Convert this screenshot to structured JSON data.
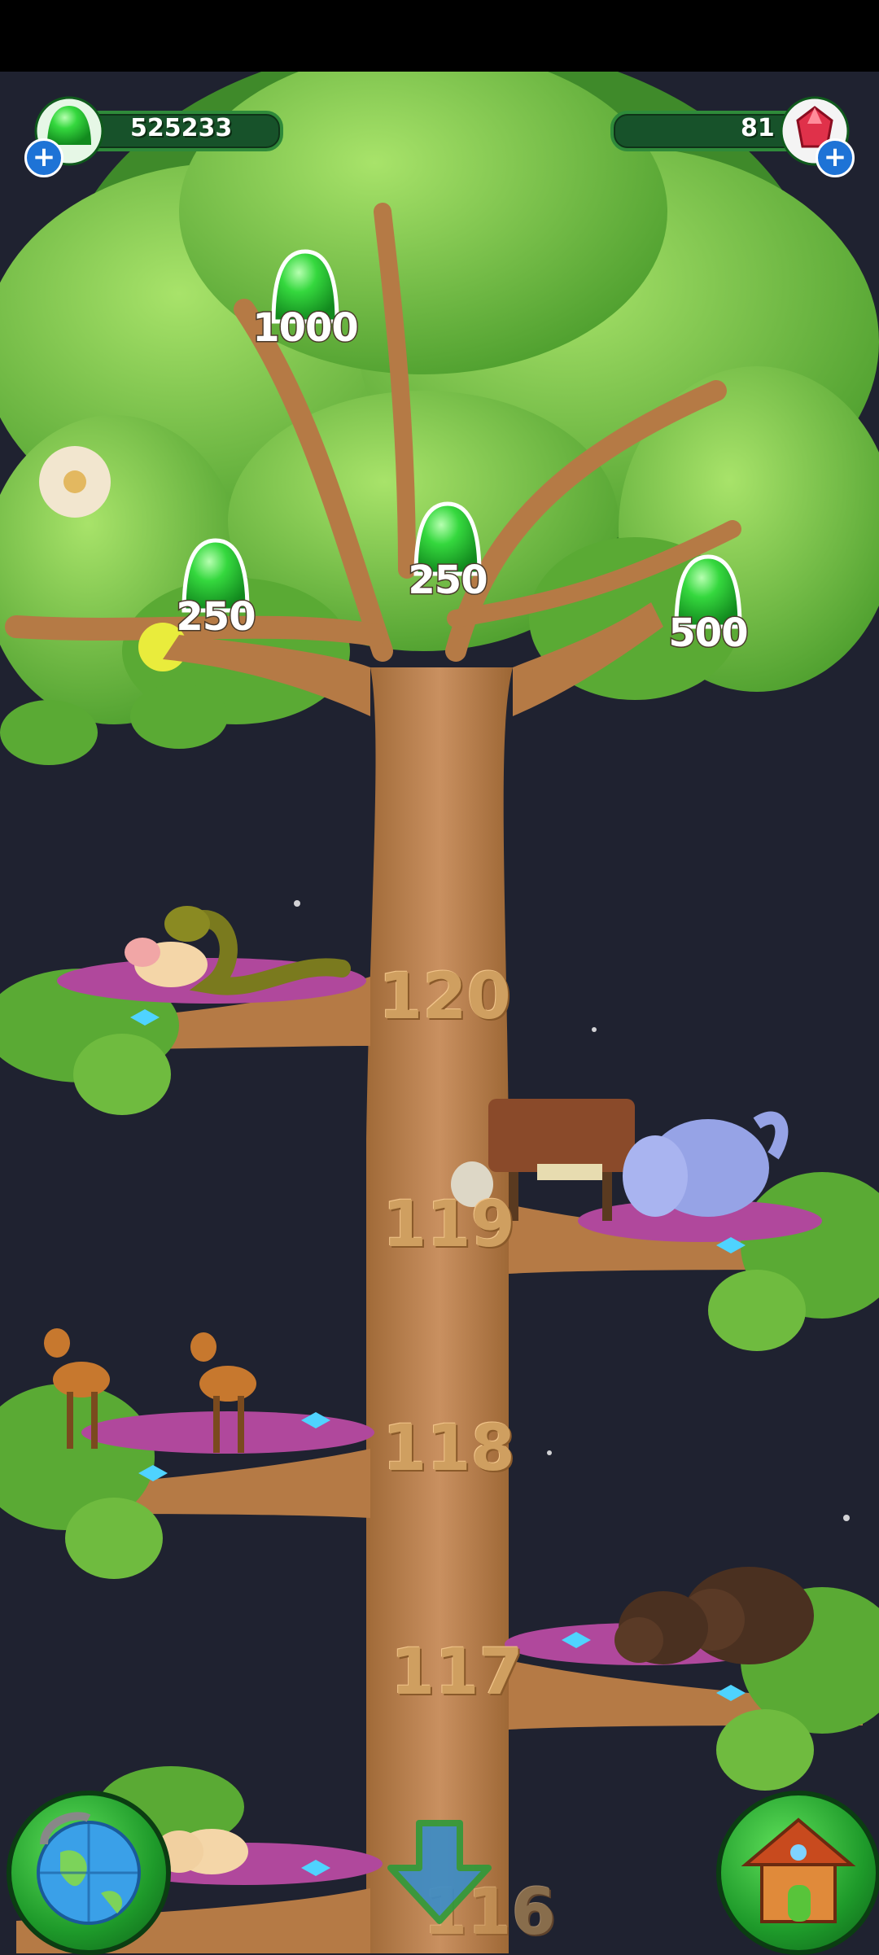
{
  "hud": {
    "currency": {
      "value": "525233",
      "icon": "green-drop-icon",
      "add_icon": "plus-icon"
    },
    "gems": {
      "value": "81",
      "icon": "red-gem-icon",
      "add_icon": "plus-icon"
    }
  },
  "rewards": [
    {
      "amount": "1000",
      "icon": "green-drop-icon"
    },
    {
      "amount": "250",
      "icon": "green-drop-icon"
    },
    {
      "amount": "250",
      "icon": "green-drop-icon"
    },
    {
      "amount": "500",
      "icon": "green-drop-icon"
    }
  ],
  "levels": [
    "120",
    "119",
    "118",
    "117",
    "116"
  ],
  "buttons": {
    "world": {
      "icon": "globe-icon"
    },
    "scroll_down": {
      "icon": "down-arrow-icon"
    },
    "home": {
      "icon": "house-icon"
    }
  },
  "colors": {
    "sky": "#1f2230",
    "trunk": "#b57a45",
    "leaf": "#7cc84a",
    "leaf_dark": "#3f8a2a",
    "hud_bar": "#17522a",
    "drop": "#2ecc40"
  }
}
